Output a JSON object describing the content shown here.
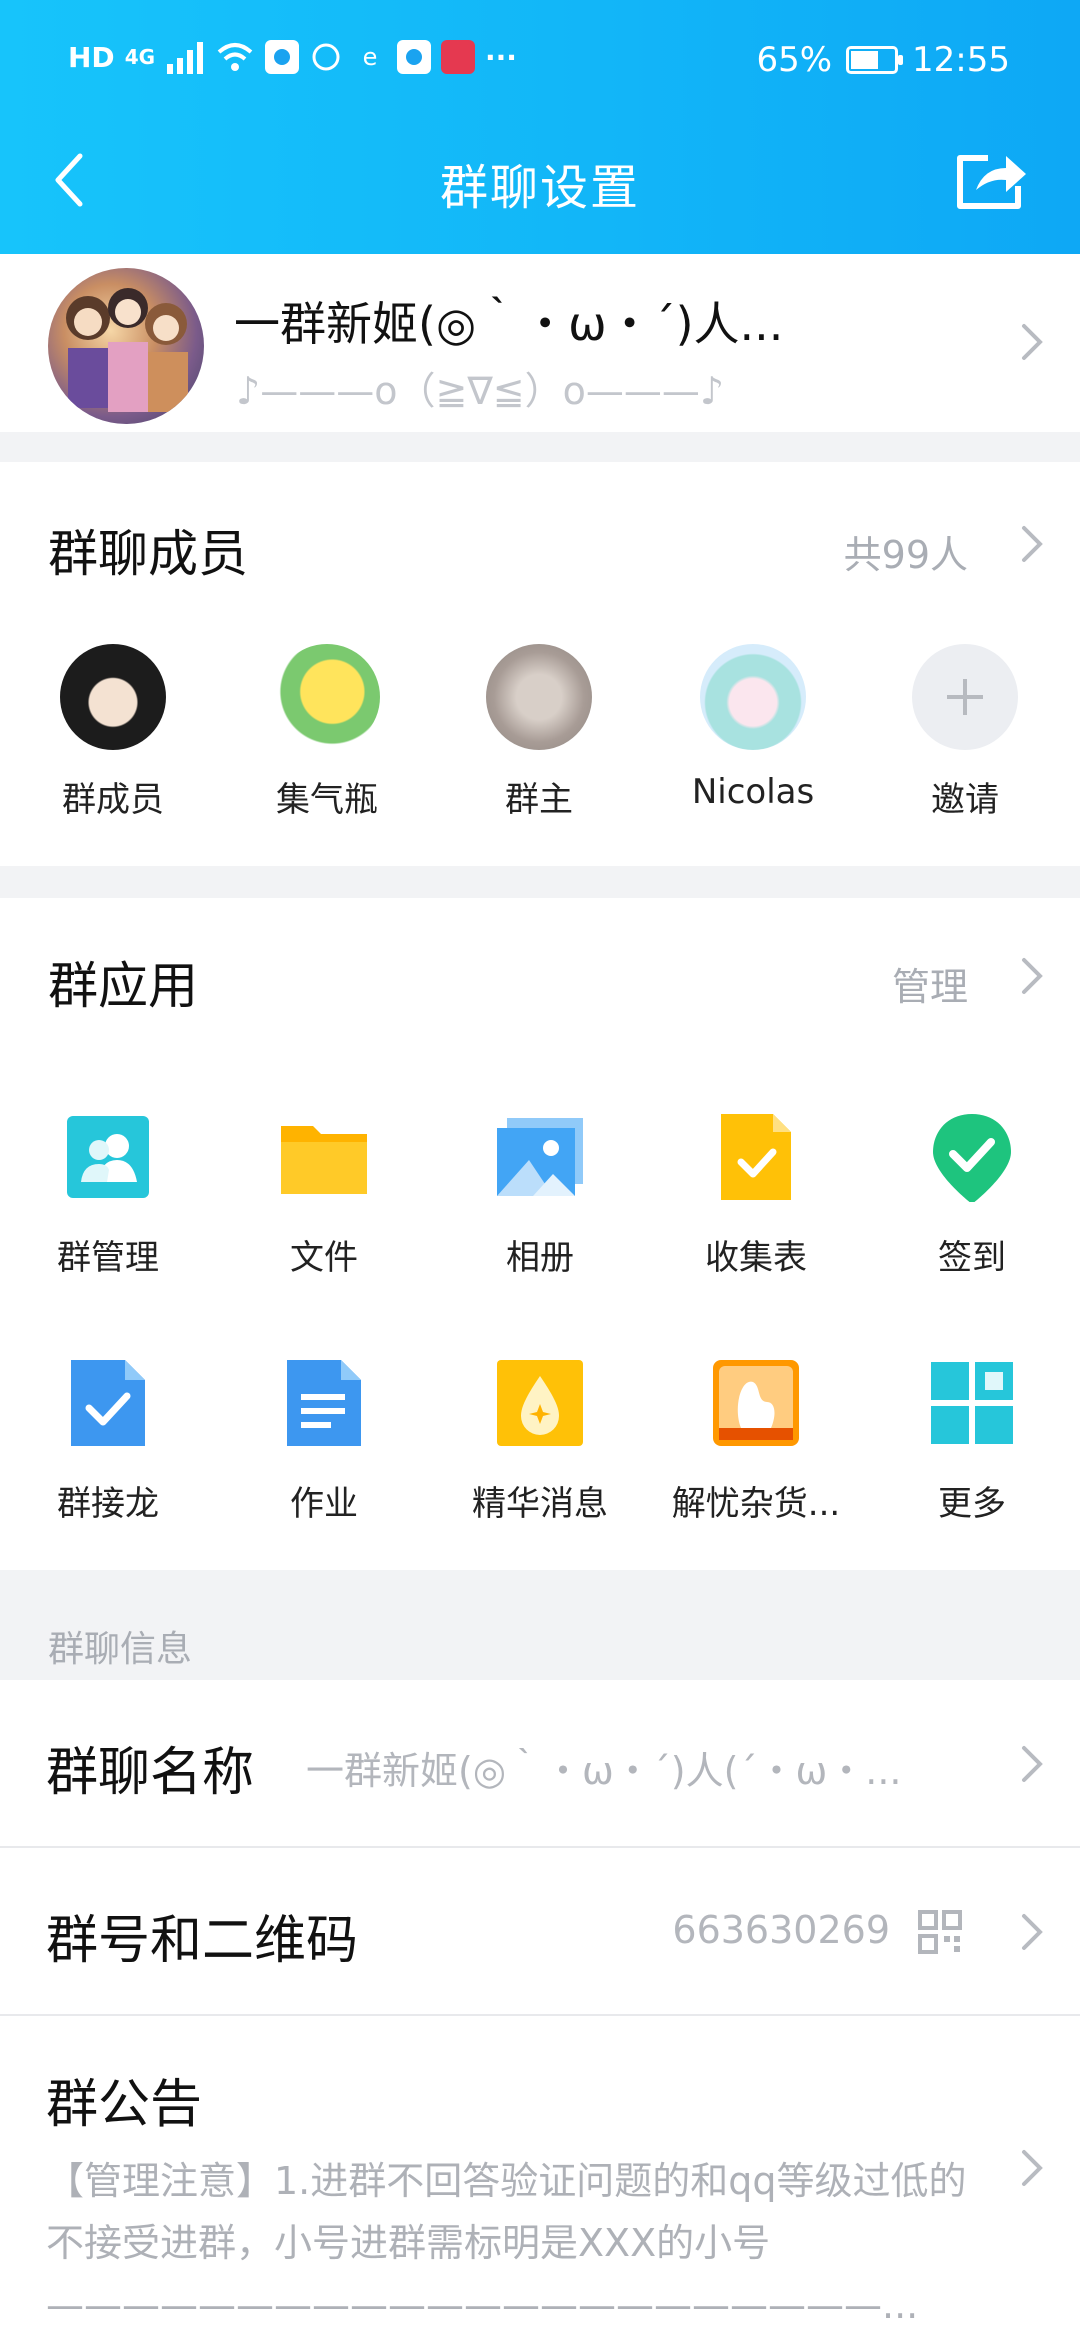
{
  "statusbar": {
    "left_text": "HD",
    "signal": "4G",
    "more": "···",
    "battery_text": "65%",
    "battery_level": 0.65,
    "time": "12:55"
  },
  "nav": {
    "title": "群聊设置",
    "back_icon": "chevron-left-icon",
    "share_icon": "share-icon"
  },
  "group": {
    "name": "一群新姬(◎｀・ω・´)人...",
    "subtitle": "♪———o（≧∇≦）o———♪"
  },
  "members": {
    "title": "群聊成员",
    "count": "共99人",
    "list": [
      {
        "name": "群成员"
      },
      {
        "name": "集气瓶"
      },
      {
        "name": "群主"
      },
      {
        "name": "Nicolas"
      },
      {
        "name": "邀请"
      }
    ]
  },
  "apps": {
    "title": "群应用",
    "manage": "管理",
    "items": [
      {
        "label": "群管理",
        "icon": "group-manage-icon",
        "color": "#26c6da"
      },
      {
        "label": "文件",
        "icon": "folder-icon",
        "color": "#ffc107"
      },
      {
        "label": "相册",
        "icon": "photo-album-icon",
        "color": "#42a5f5"
      },
      {
        "label": "收集表",
        "icon": "form-icon",
        "color": "#ffc107"
      },
      {
        "label": "签到",
        "icon": "check-in-icon",
        "color": "#1ec47e"
      },
      {
        "label": "群接龙",
        "icon": "solitaire-icon",
        "color": "#3d97f0"
      },
      {
        "label": "作业",
        "icon": "homework-icon",
        "color": "#3d97f0"
      },
      {
        "label": "精华消息",
        "icon": "essence-icon",
        "color": "#ffc107"
      },
      {
        "label": "解忧杂货...",
        "icon": "grocery-icon",
        "color": "#ff9800"
      },
      {
        "label": "更多",
        "icon": "grid-more-icon",
        "color": "#26c6da"
      }
    ]
  },
  "info": {
    "section": "群聊信息",
    "name_title": "群聊名称",
    "name_value": "一群新姬(◎｀・ω・´)人(´・ω・...",
    "number_title": "群号和二维码",
    "number_value": "663630269",
    "notice_title": "群公告",
    "notice_text": "【管理注意】1.进群不回答验证问题的和qq等级过低的不接受进群，小号进群需标明是XXX的小号——————————————————————..."
  },
  "colors": {
    "header_start": "#17c4fb",
    "header_end": "#0ea8f5",
    "muted": "#a9adb4"
  }
}
